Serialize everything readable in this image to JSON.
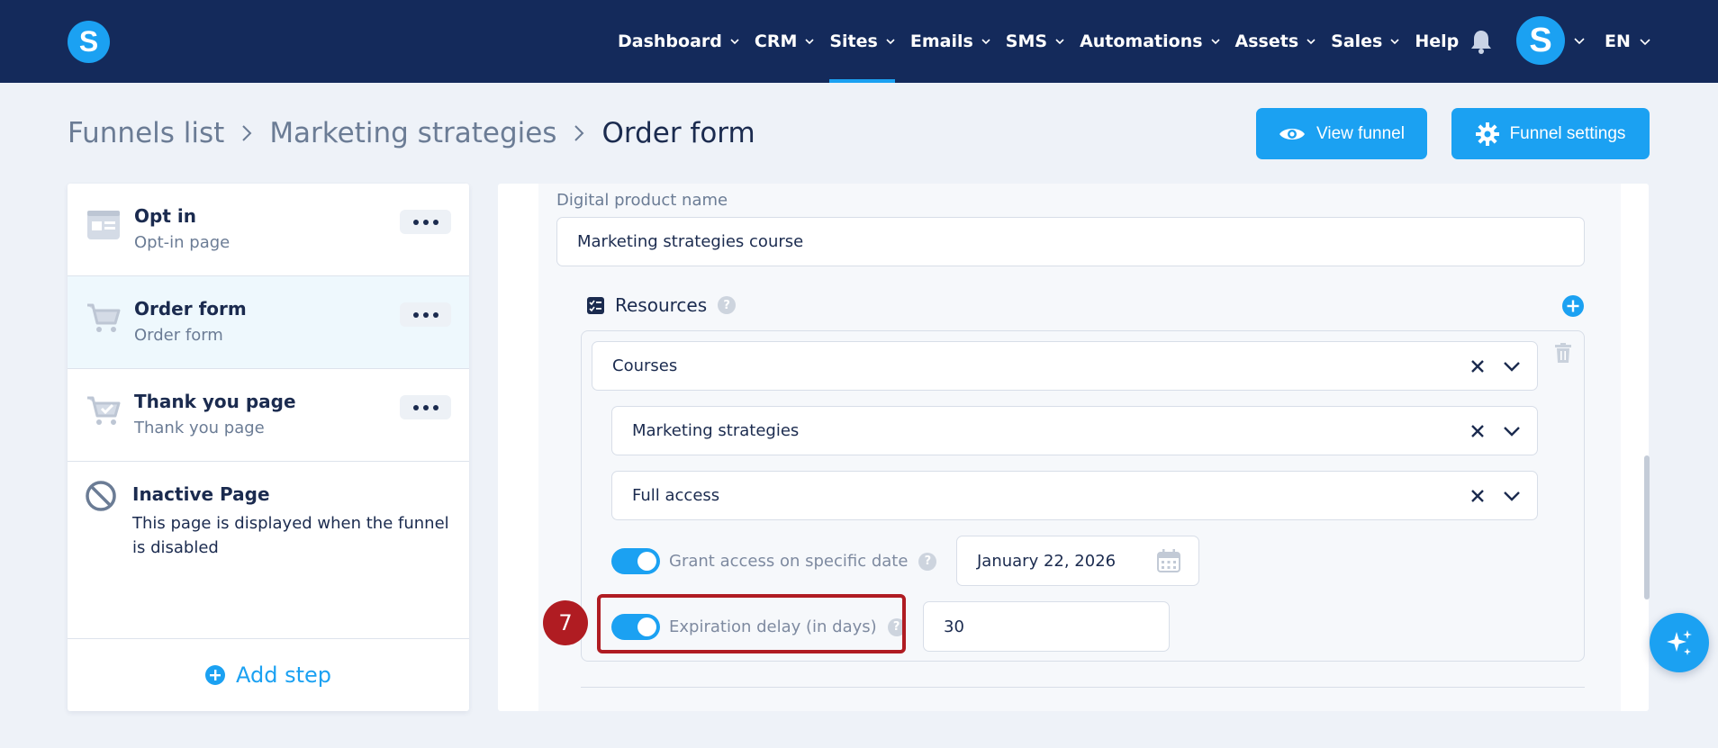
{
  "nav": {
    "logo": "S",
    "items": [
      {
        "label": "Dashboard",
        "dropdown": true,
        "active": false
      },
      {
        "label": "CRM",
        "dropdown": true,
        "active": false
      },
      {
        "label": "Sites",
        "dropdown": true,
        "active": true
      },
      {
        "label": "Emails",
        "dropdown": true,
        "active": false
      },
      {
        "label": "SMS",
        "dropdown": true,
        "active": false
      },
      {
        "label": "Automations",
        "dropdown": true,
        "active": false
      },
      {
        "label": "Assets",
        "dropdown": true,
        "active": false
      },
      {
        "label": "Sales",
        "dropdown": true,
        "active": false
      },
      {
        "label": "Help",
        "dropdown": false,
        "active": false
      }
    ],
    "avatar_initial": "S",
    "language": "EN"
  },
  "breadcrumb": {
    "items": [
      "Funnels list",
      "Marketing strategies",
      "Order form"
    ]
  },
  "actions": {
    "view_funnel": "View funnel",
    "funnel_settings": "Funnel settings"
  },
  "steps": [
    {
      "title": "Opt in",
      "subtitle": "Opt-in page",
      "icon": "page-layout-icon"
    },
    {
      "title": "Order form",
      "subtitle": "Order form",
      "icon": "cart-icon"
    },
    {
      "title": "Thank you page",
      "subtitle": "Thank you page",
      "icon": "cart-check-icon"
    }
  ],
  "inactive_page": {
    "title": "Inactive Page",
    "description": "This page is displayed when the funnel is disabled"
  },
  "add_step": "Add step",
  "form": {
    "product_name_label": "Digital product name",
    "product_name_value": "Marketing strategies course",
    "resources_label": "Resources",
    "resource_type": "Courses",
    "course": "Marketing strategies",
    "access": "Full access",
    "grant_access_label": "Grant access on specific date",
    "grant_access_date": "January 22, 2026",
    "expiration_label": "Expiration delay (in days)",
    "expiration_value": "30"
  },
  "annotation": {
    "step_number": "7"
  },
  "colors": {
    "navbar": "#142a5b",
    "accent": "#1ba1f2",
    "highlight": "#b01c22"
  }
}
